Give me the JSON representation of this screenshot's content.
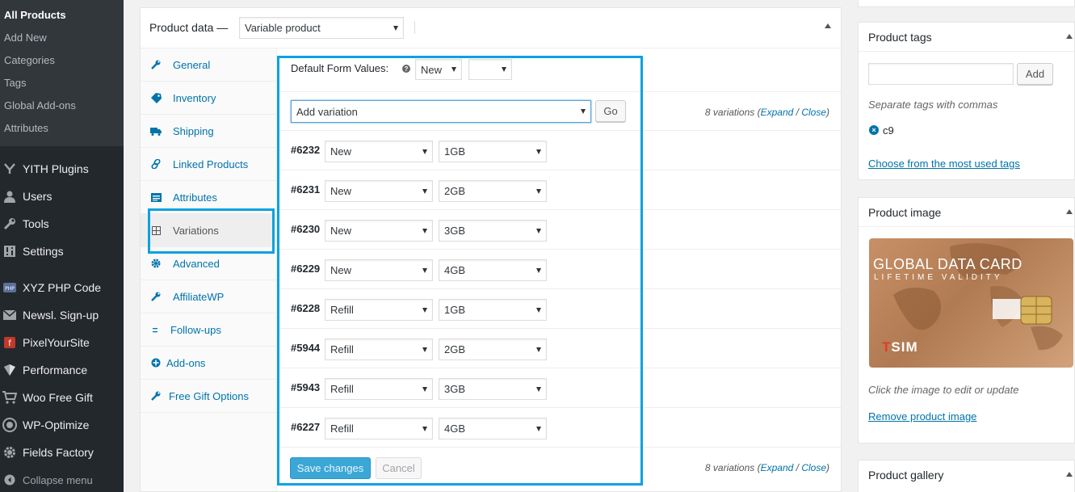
{
  "admin_menu": {
    "submenu": [
      {
        "label": "All Products",
        "current": true
      },
      {
        "label": "Add New"
      },
      {
        "label": "Categories"
      },
      {
        "label": "Tags"
      },
      {
        "label": "Global Add-ons"
      },
      {
        "label": "Attributes"
      }
    ],
    "items": [
      {
        "label": "YITH Plugins",
        "icon": "yith-icon"
      },
      {
        "label": "Users",
        "icon": "users-icon"
      },
      {
        "label": "Tools",
        "icon": "tools-icon"
      },
      {
        "label": "Settings",
        "icon": "settings-icon"
      },
      {
        "label": "XYZ PHP Code",
        "icon": "php-icon"
      },
      {
        "label": "Newsl. Sign-up",
        "icon": "mail-icon"
      },
      {
        "label": "PixelYourSite",
        "icon": "pixelyoursite-icon"
      },
      {
        "label": "Performance",
        "icon": "performance-icon"
      },
      {
        "label": "Woo Free Gift",
        "icon": "cart-icon"
      },
      {
        "label": "WP-Optimize",
        "icon": "optimize-icon"
      },
      {
        "label": "Fields Factory",
        "icon": "gear-icon"
      }
    ],
    "collapse_label": "Collapse menu"
  },
  "product_data": {
    "title": "Product data —",
    "type_select": "Variable product",
    "tabs": [
      {
        "label": "General",
        "icon": "wrench-icon"
      },
      {
        "label": "Inventory",
        "icon": "tag-icon"
      },
      {
        "label": "Shipping",
        "icon": "truck-icon"
      },
      {
        "label": "Linked Products",
        "icon": "link-icon"
      },
      {
        "label": "Attributes",
        "icon": "list-icon"
      },
      {
        "label": "Variations",
        "icon": "grid-icon",
        "active": true
      },
      {
        "label": "Advanced",
        "icon": "gear-icon"
      },
      {
        "label": "AffiliateWP",
        "icon": "wrench-icon"
      },
      {
        "label": "Follow-ups",
        "icon": "dash-icon"
      },
      {
        "label": "Add-ons",
        "icon": "plus-circle-icon"
      },
      {
        "label": "Free Gift Options",
        "icon": "wrench-icon"
      }
    ],
    "default_form_label": "Default Form Values:",
    "default_select_1": "New",
    "default_select_2": "",
    "add_variation_select": "Add variation",
    "go_label": "Go",
    "variation_count_text": "8 variations (",
    "expand_label": "Expand",
    "slash": " / ",
    "close_label": "Close",
    "close_paren": ")",
    "variations": [
      {
        "id": "#6232",
        "type": "New",
        "size": "1GB"
      },
      {
        "id": "#6231",
        "type": "New",
        "size": "2GB"
      },
      {
        "id": "#6230",
        "type": "New",
        "size": "3GB"
      },
      {
        "id": "#6229",
        "type": "New",
        "size": "4GB"
      },
      {
        "id": "#6228",
        "type": "Refill",
        "size": "1GB"
      },
      {
        "id": "#5944",
        "type": "Refill",
        "size": "2GB"
      },
      {
        "id": "#5943",
        "type": "Refill",
        "size": "3GB"
      },
      {
        "id": "#6227",
        "type": "Refill",
        "size": "4GB"
      }
    ],
    "save_label": "Save changes",
    "cancel_label": "Cancel",
    "highlight_color": "#0aa2e0"
  },
  "product_tags": {
    "title": "Product tags",
    "add_label": "Add",
    "input_value": "",
    "hint": "Separate tags with commas",
    "tags": [
      "c9"
    ],
    "most_used_link": "Choose from the most used tags"
  },
  "product_image": {
    "title": "Product image",
    "card_title": "GLOBAL DATA CARD",
    "card_subtitle": "LIFETIME VALIDITY",
    "card_brand_red": "T",
    "card_brand_rest": "SIM",
    "hint": "Click the image to edit or update",
    "remove_link": "Remove product image"
  },
  "product_gallery": {
    "title": "Product gallery"
  }
}
